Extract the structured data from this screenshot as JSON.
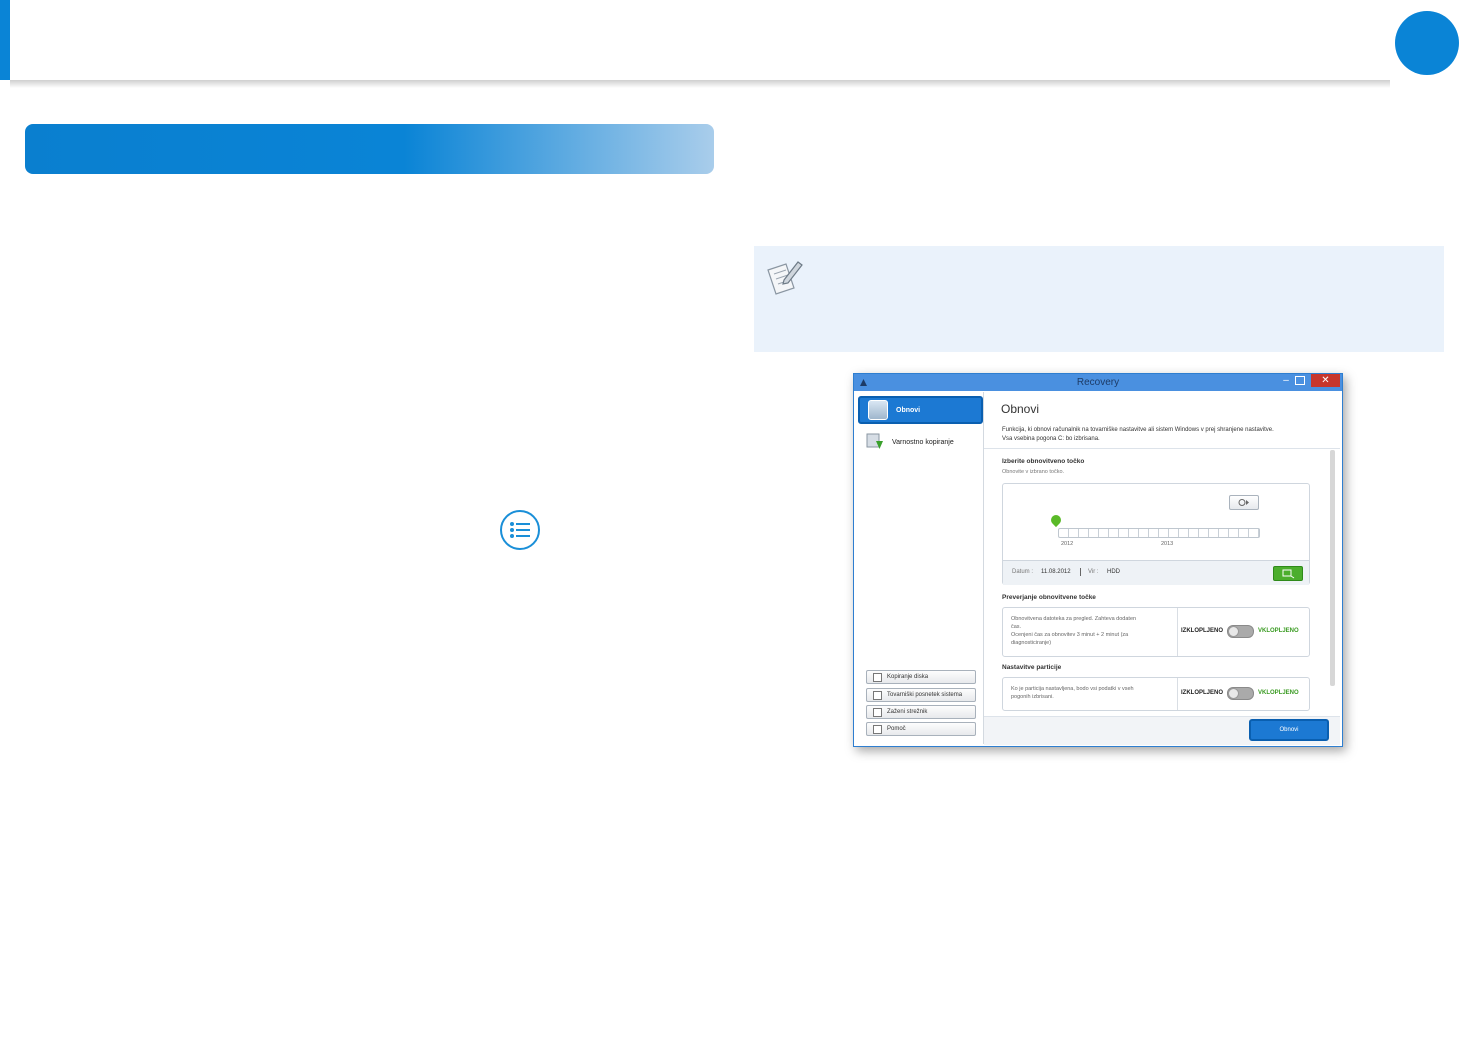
{
  "window": {
    "title": "Recovery",
    "minimize": "–",
    "close": "✕"
  },
  "sidebar": {
    "items": [
      {
        "label": "Obnovi"
      },
      {
        "label": "Varnostno kopiranje"
      }
    ],
    "buttons": [
      {
        "label": "Kopiranje diska"
      },
      {
        "label": "Tovarniški posnetek sistema"
      },
      {
        "label": "Zaženi strežnik"
      },
      {
        "label": "Pomoč"
      }
    ]
  },
  "main": {
    "title": "Obnovi",
    "description_line1": "Funkcija, ki obnovi računalnik na tovarniške nastavitve ali sistem Windows v prej shranjene nastavitve.",
    "description_line2": "Vsa vsebina pogona C: bo izbrisana.",
    "restore_point": {
      "heading": "Izberite obnovitveno točko",
      "subheading": "Obnovite v izbrano točko.",
      "years": [
        "2012",
        "2013"
      ],
      "date_label": "Datum :",
      "date_value": "11.08.2012",
      "source_label": "Vir :",
      "source_value": "HDD"
    },
    "verify": {
      "heading": "Preverjanje obnovitvene točke",
      "text_line1": "Obnovitvena datoteka za pregled. Zahteva dodaten",
      "text_line2": "čas.",
      "text_line3": "Ocenjeni čas za obnovitev 3 minut + 2 minut (za",
      "text_line4": "diagnosticiranje)",
      "off_label": "IZKLOPLJENO",
      "on_label": "VKLOPLJENO"
    },
    "partition": {
      "heading": "Nastavitve particije",
      "text_line1": "Ko je particija nastavljena, bodo vsi podatki v vseh",
      "text_line2": "pogonih izbrisani.",
      "off_label": "IZKLOPLJENO",
      "on_label": "VKLOPLJENO"
    },
    "obnovi_button": "Obnovi"
  },
  "colors": {
    "accent": "#0a84d6",
    "button_blue": "#1c79d3",
    "on_green": "#3a9b22"
  }
}
